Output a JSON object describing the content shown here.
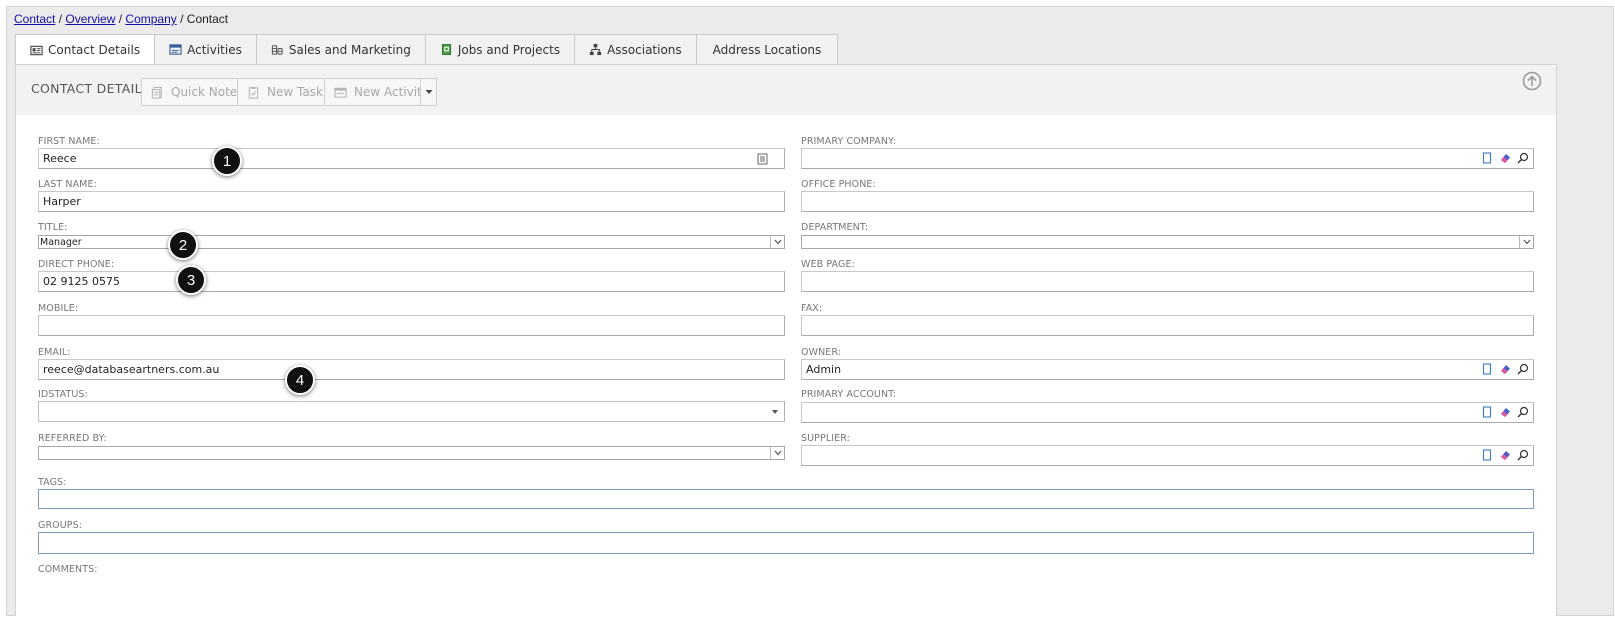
{
  "breadcrumb": [
    {
      "label": "Contact",
      "link": true
    },
    {
      "label": "Overview",
      "link": true
    },
    {
      "label": "Company",
      "link": true
    },
    {
      "label": "Contact",
      "link": false
    }
  ],
  "tabs": [
    {
      "label": "Contact Details",
      "icon": "id-card-icon",
      "active": true
    },
    {
      "label": "Activities",
      "icon": "calendar-icon"
    },
    {
      "label": "Sales and Marketing",
      "icon": "coins-icon"
    },
    {
      "label": "Jobs and Projects",
      "icon": "project-icon"
    },
    {
      "label": "Associations",
      "icon": "hierarchy-icon"
    },
    {
      "label": "Address Locations",
      "icon": ""
    }
  ],
  "toolbar": {
    "title": "CONTACT DETAILS",
    "quick_note": "Quick Note",
    "new_task": "New Task",
    "new_activity": "New Activity"
  },
  "form": {
    "first_name": {
      "label": "FIRST NAME:",
      "value": "Reece"
    },
    "last_name": {
      "label": "LAST NAME:",
      "value": "Harper"
    },
    "title": {
      "label": "TITLE:",
      "value": "Manager"
    },
    "direct_phone": {
      "label": "DIRECT PHONE:",
      "value": "02 9125 0575"
    },
    "mobile": {
      "label": "MOBILE:",
      "value": ""
    },
    "email": {
      "label": "EMAIL:",
      "value": "reece@databaseartners.com.au"
    },
    "idstatus": {
      "label": "IDSTATUS:",
      "value": ""
    },
    "referred_by": {
      "label": "REFERRED BY:",
      "value": ""
    },
    "primary_company": {
      "label": "PRIMARY COMPANY:",
      "value": ""
    },
    "office_phone": {
      "label": "OFFICE PHONE:",
      "value": ""
    },
    "department": {
      "label": "DEPARTMENT:",
      "value": ""
    },
    "web_page": {
      "label": "WEB PAGE:",
      "value": ""
    },
    "fax": {
      "label": "FAX:",
      "value": ""
    },
    "owner": {
      "label": "OWNER:",
      "value": "Admin"
    },
    "primary_account": {
      "label": "PRIMARY ACCOUNT:",
      "value": ""
    },
    "supplier": {
      "label": "SUPPLIER:",
      "value": ""
    },
    "tags": {
      "label": "TAGS:",
      "value": ""
    },
    "groups": {
      "label": "GROUPS:",
      "value": ""
    },
    "comments": {
      "label": "COMMENTS:"
    }
  },
  "callouts": [
    "1",
    "2",
    "3",
    "4"
  ],
  "colors": {
    "accent": "#1a0dab",
    "field_focus": "#7a9cbd",
    "callout": "#111111"
  }
}
